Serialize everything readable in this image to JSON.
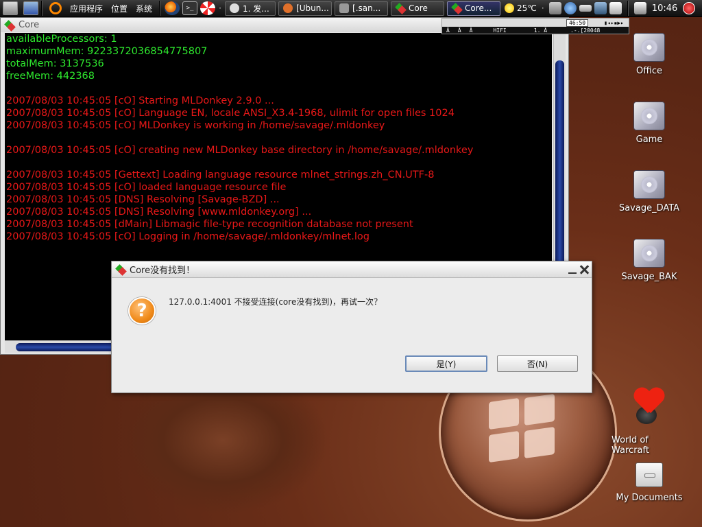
{
  "panel": {
    "menus": [
      "应用程序",
      "位置",
      "系统"
    ],
    "tasks": [
      {
        "label": "1. 发...",
        "icon_color": "#dddddd"
      },
      {
        "label": "[Ubun...",
        "icon_color": "#e0702a"
      },
      {
        "label": "[.san...",
        "icon_color": "#999999"
      },
      {
        "label": "Core",
        "icon_color": "#2aa02a"
      },
      {
        "label": "Core...",
        "icon_color": "#2aa02a",
        "active": true
      }
    ],
    "weather": "25℃",
    "clock": "10:46"
  },
  "core_window": {
    "title": "Core",
    "lines": [
      {
        "text": "availableProcessors: 1",
        "color": "green"
      },
      {
        "text": "maximumMem: 9223372036854775807",
        "color": "green"
      },
      {
        "text": "totalMem: 3137536",
        "color": "green"
      },
      {
        "text": "freeMem: 442368",
        "color": "green"
      },
      {
        "text": "",
        "color": "blank"
      },
      {
        "text": "2007/08/03 10:45:05 [cO] Starting MLDonkey 2.9.0 ...",
        "color": "red"
      },
      {
        "text": "2007/08/03 10:45:05 [cO] Language EN, locale ANSI_X3.4-1968, ulimit for open files 1024",
        "color": "red"
      },
      {
        "text": "2007/08/03 10:45:05 [cO] MLDonkey is working in /home/savage/.mldonkey",
        "color": "red"
      },
      {
        "text": "",
        "color": "blank"
      },
      {
        "text": "2007/08/03 10:45:05 [cO] creating new MLDonkey base directory in /home/savage/.mldonkey",
        "color": "red"
      },
      {
        "text": "",
        "color": "blank"
      },
      {
        "text": "2007/08/03 10:45:05 [Gettext] Loading language resource mlnet_strings.zh_CN.UTF-8",
        "color": "red"
      },
      {
        "text": "2007/08/03 10:45:05 [cO] loaded language resource file",
        "color": "red"
      },
      {
        "text": "2007/08/03 10:45:05 [DNS] Resolving [Savage-BZD] ...",
        "color": "red"
      },
      {
        "text": "2007/08/03 10:45:05 [DNS] Resolving [www.mldonkey.org] ...",
        "color": "red"
      },
      {
        "text": "2007/08/03 10:45:05 [dMain] Libmagic file-type recognition database not present",
        "color": "red"
      },
      {
        "text": "2007/08/03 10:45:05 [cO] Logging in /home/savage/.mldonkey/mlnet.log",
        "color": "red"
      }
    ]
  },
  "player": {
    "time": "46:50",
    "row2": [
      "Â",
      "Â",
      "Â",
      "HIFI",
      "1. Â",
      ".-.[20048"
    ]
  },
  "desktop_icons": [
    {
      "label": "Office"
    },
    {
      "label": "Game"
    },
    {
      "label": "Savage_DATA"
    },
    {
      "label": "Savage_BAK"
    },
    {
      "label": "World of Warcraft"
    },
    {
      "label": "My Documents"
    }
  ],
  "dialog": {
    "title": "Core没有找到！",
    "message": "127.0.0.1:4001 不接受连接(core没有找到)，再试一次？",
    "yes_label": "是(Y)",
    "no_label": "否(N)"
  },
  "colors": {
    "console_green": "#2ee82e",
    "console_red": "#e81818",
    "scroll_thumb": "#1c3484"
  }
}
